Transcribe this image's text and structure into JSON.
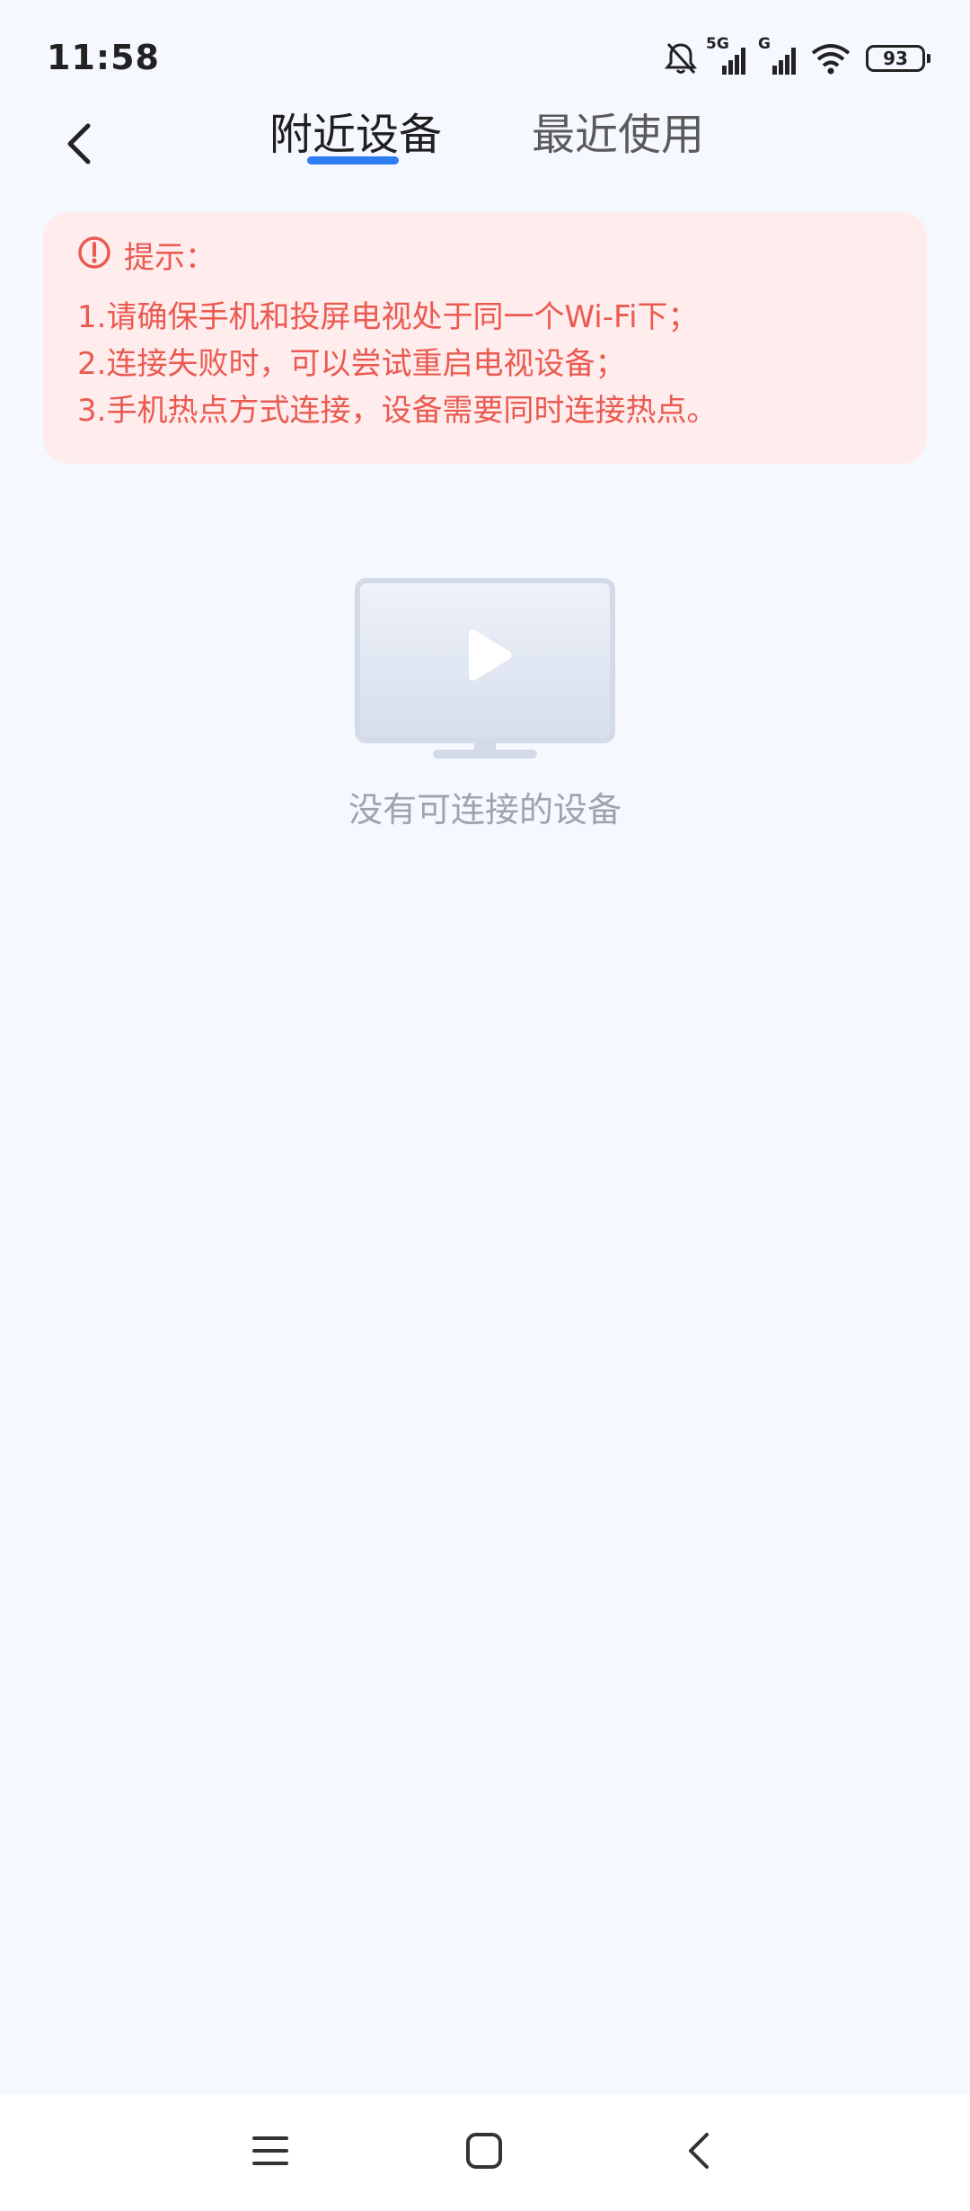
{
  "status_bar": {
    "time": "11:58",
    "mute_icon": "bell-off-icon",
    "signal_1_label": "5G",
    "signal_2_label": "G",
    "wifi_icon": "wifi-icon",
    "battery_level": "93"
  },
  "header": {
    "back_icon": "chevron-left-icon",
    "tabs": [
      {
        "label": "附近设备",
        "active": true
      },
      {
        "label": "最近使用",
        "active": false
      }
    ],
    "active_color": "#2f7bf0"
  },
  "tips": {
    "icon": "alert-circle-icon",
    "title": "提示：",
    "lines": [
      "1.请确保手机和投屏电视处于同一个Wi-Fi下；",
      "2.连接失败时，可以尝试重启电视设备；",
      "3.手机热点方式连接，设备需要同时连接热点。"
    ],
    "text_color": "#ea5a50",
    "background": "#ffeced"
  },
  "empty_state": {
    "icon": "tv-play-icon",
    "message": "没有可连接的设备"
  },
  "nav_bar": {
    "menu_icon": "menu-icon",
    "home_icon": "home-square-icon",
    "back_icon": "back-chevron-icon"
  }
}
